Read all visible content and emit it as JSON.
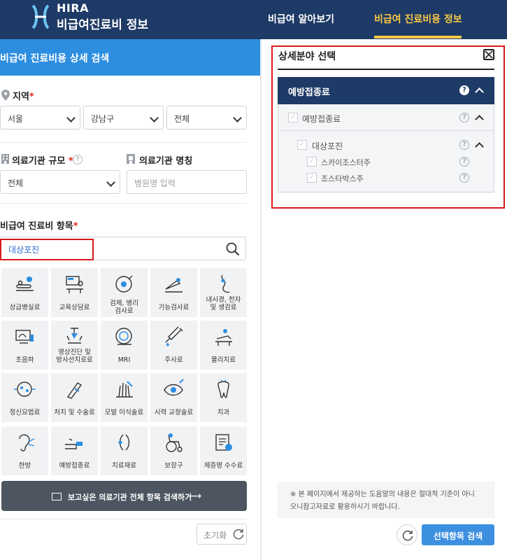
{
  "header": {
    "logo_main": "HIRA",
    "logo_sub": "비급여진료비 정보",
    "nav": [
      "비급여 알아보기",
      "비급여 진료비용 정보"
    ]
  },
  "left": {
    "title": "비급여 진료비용 상세 검색",
    "region_label": "지역",
    "region_values": [
      "서울",
      "강남구",
      "전체"
    ],
    "scale_label": "의료기관 규모",
    "scale_value": "전체",
    "name_label": "의료기관 명칭",
    "name_placeholder": "병원명 입력",
    "item_label": "비급여 진료비 항목",
    "search_value": "대상포진",
    "required_mark": "*",
    "tiles": [
      {
        "label": "상급병실료",
        "icon": "hospital-bed"
      },
      {
        "label": "교육상담료",
        "icon": "counseling"
      },
      {
        "label": "검체, 병리\n검사료",
        "icon": "lab-test"
      },
      {
        "label": "기능검사료",
        "icon": "function-test"
      },
      {
        "label": "내시경, 천자\n및 생검료",
        "icon": "endoscope"
      },
      {
        "label": "초음파",
        "icon": "ultrasound"
      },
      {
        "label": "영상진단 및\n방사선치료료",
        "icon": "radiology"
      },
      {
        "label": "MRI",
        "icon": "mri"
      },
      {
        "label": "주사료",
        "icon": "syringe"
      },
      {
        "label": "물리치료",
        "icon": "physiotherapy"
      },
      {
        "label": "정신요법료",
        "icon": "brain"
      },
      {
        "label": "처치 및 수술료",
        "icon": "surgery"
      },
      {
        "label": "모발 이식술료",
        "icon": "hair"
      },
      {
        "label": "시력 교정술료",
        "icon": "eye"
      },
      {
        "label": "치과",
        "icon": "tooth"
      },
      {
        "label": "한방",
        "icon": "acupuncture"
      },
      {
        "label": "예방접종료",
        "icon": "vaccine"
      },
      {
        "label": "치료재료",
        "icon": "material"
      },
      {
        "label": "보장구",
        "icon": "wheelchair"
      },
      {
        "label": "제증명 수수료",
        "icon": "certificate"
      }
    ],
    "search_all_button": "보고싶은 의료기관 전체 항목 검색하기",
    "reset_button": "초기화"
  },
  "right": {
    "title": "상세분야 선택",
    "group_header": "예방접종료",
    "tree": [
      {
        "label": "예방접종료",
        "level": 1
      },
      {
        "label": "대상포진",
        "level": 2
      },
      {
        "label": "스카이조스터주",
        "level": 3
      },
      {
        "label": "조스타박스주",
        "level": 3
      }
    ],
    "notice": [
      "※ 본 페이지에서 제공하는 도움말의 내용은 절대적 기준이 아니",
      "오니참고자료로 활용하시기 바랍니다."
    ],
    "submit_button": "선택항목 검색"
  },
  "colors": {
    "header_bg": "#1e3a66",
    "accent_yellow": "#f7c844",
    "left_title_bg": "#2d8ee0",
    "required_red": "#e0261b",
    "highlight_red": "#d9191c",
    "submit_blue": "#3d8fe0"
  }
}
